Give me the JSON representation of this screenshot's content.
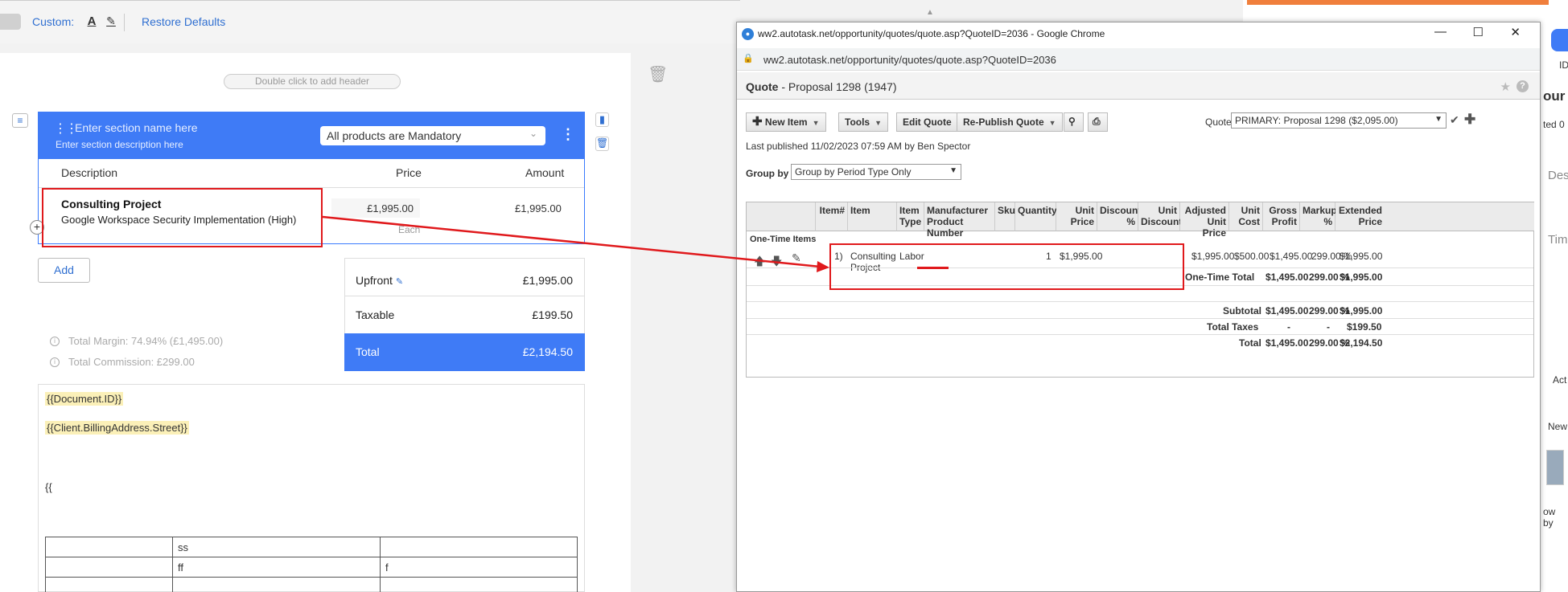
{
  "toolbar": {
    "custom_label": "Custom:",
    "restore_label": "Restore Defaults"
  },
  "header_placeholder": "Double click to add header",
  "section": {
    "name_placeholder": "Enter section name here",
    "desc_placeholder": "Enter section description here",
    "mandatory_select": "All products are Mandatory",
    "col_description": "Description",
    "col_price": "Price",
    "col_amount": "Amount",
    "item_title": "Consulting Project",
    "item_subtitle": "Google Workspace Security Implementation (High)",
    "item_price": "£1,995.00",
    "item_amount": "£1,995.00",
    "item_unit": "Each",
    "add_label": "Add"
  },
  "summary": {
    "upfront_label": "Upfront",
    "upfront_value": "£1,995.00",
    "taxable_label": "Taxable",
    "taxable_value": "£199.50",
    "total_label": "Total",
    "total_value": "£2,194.50",
    "margin_text": "Total Margin:  74.94% (£1,495.00)",
    "commission_text": "Total Commission:  £299.00"
  },
  "document": {
    "tag1": "{{Document.ID}}",
    "tag2": "{{Client.BillingAddress.Street}}",
    "brace": "{{",
    "table": [
      [
        "",
        "ss",
        ""
      ],
      [
        "",
        "ff",
        "f"
      ],
      [
        "",
        "",
        ""
      ]
    ]
  },
  "window": {
    "title": "ww2.autotask.net/opportunity/quotes/quote.asp?QuoteID=2036 - Google Chrome",
    "url": "ww2.autotask.net/opportunity/quotes/quote.asp?QuoteID=2036",
    "quote_title_bold": "Quote",
    "quote_title_rest": " - Proposal 1298 (1947)",
    "buttons": {
      "new_item": "New Item",
      "tools": "Tools",
      "edit_quote": "Edit Quote",
      "republish": "Re-Publish Quote"
    },
    "quote_label": "Quote",
    "quote_select": "PRIMARY: Proposal 1298 ($2,095.00)",
    "last_published": "Last published 11/02/2023 07:59 AM by Ben Spector",
    "group_by_label": "Group by",
    "group_by_select": "Group by Period Type Only",
    "columns": [
      "Item#",
      "Item",
      "Item Type",
      "Manufacturer Product Number",
      "Sku",
      "Quantity",
      "Unit Price",
      "Discount %",
      "Unit Discount",
      "Adjusted Unit Price",
      "Unit Cost",
      "Gross Profit",
      "Markup %",
      "Extended Price"
    ],
    "group_name": "One-Time Items",
    "row": {
      "num": "1)",
      "item_line1": "Consulting",
      "item_line2": "Project",
      "type": "Labor",
      "qty": "1",
      "unit_price": "$1,995.00",
      "adjusted": "$1,995.00",
      "cost": "$500.00",
      "gross": "$1,495.00",
      "markup": "299.00 %",
      "extended": "$1,995.00"
    },
    "onetime_total": {
      "label": "One-Time Total",
      "gross": "$1,495.00",
      "markup": "299.00 %",
      "extended": "$1,995.00"
    },
    "subtotal": {
      "label": "Subtotal",
      "gross": "$1,495.00",
      "markup": "299.00 %",
      "extended": "$1,995.00"
    },
    "taxes": {
      "label": "Total Taxes",
      "gross": "-",
      "markup": "-",
      "extended": "$199.50"
    },
    "total": {
      "label": "Total",
      "gross": "$1,495.00",
      "markup": "299.00 %",
      "extended": "$2,194.50"
    }
  },
  "peek": {
    "p1": "our",
    "p2": "ted 0",
    "p3": "Des",
    "p4": "Tim",
    "p5": "Act",
    "p6": "New",
    "p7": "ow by",
    "p8": "ID"
  },
  "colors": {
    "accent_blue": "#3f7bf6",
    "annotation_red": "#e0191c"
  }
}
